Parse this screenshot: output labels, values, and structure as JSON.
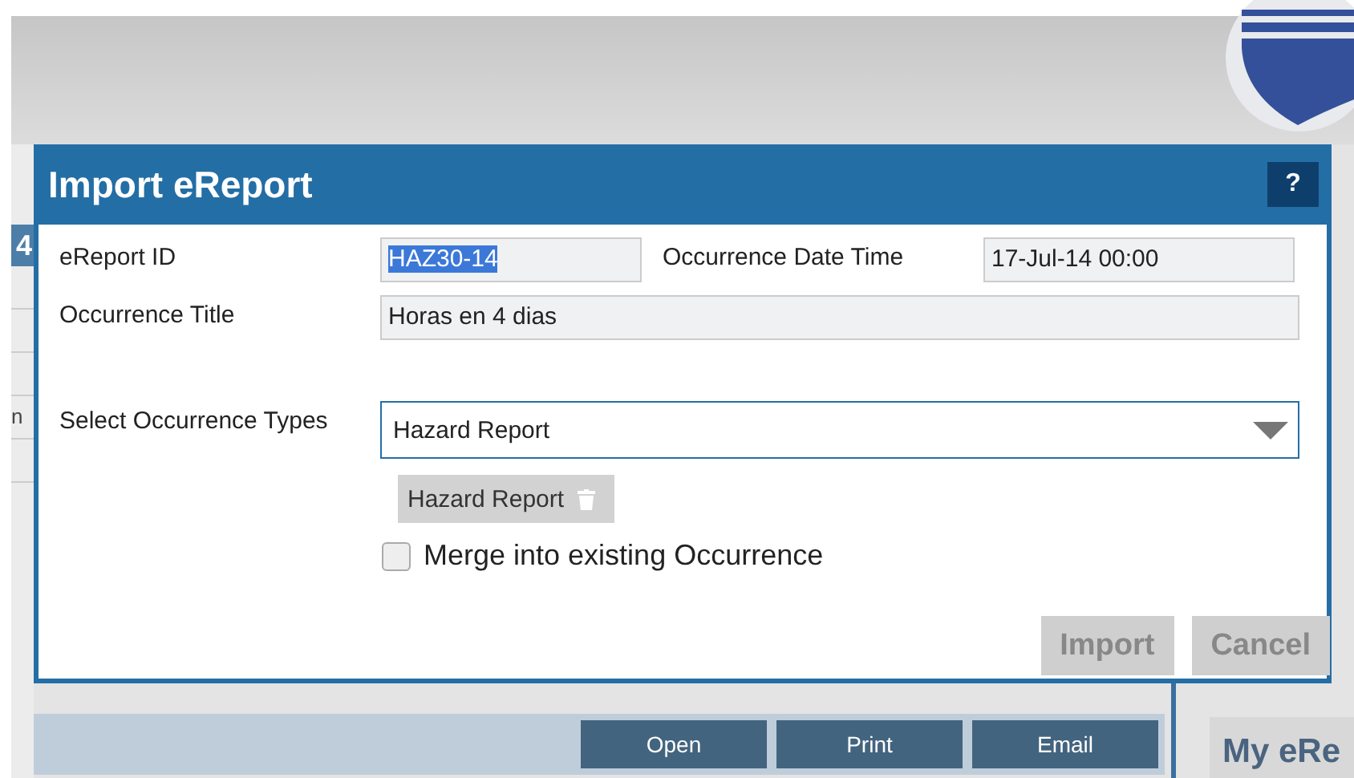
{
  "background": {
    "tab_fragment": "4",
    "row_fragment": "n",
    "toolbar_buttons": [
      "Open",
      "Print",
      "Email"
    ],
    "panel_title": "My eRe"
  },
  "dialog": {
    "title": "Import eReport",
    "help": "?",
    "report_id": {
      "label": "eReport ID",
      "value": "HAZ30-14"
    },
    "date_time": {
      "label": "Occurrence Date Time",
      "value": "17-Jul-14 00:00"
    },
    "occurrence_title": {
      "label": "Occurrence Title",
      "value": "Horas en 4 dias"
    },
    "types": {
      "label": "Select Occurrence Types",
      "value": "Hazard Report",
      "tags": [
        "Hazard Report"
      ]
    },
    "merge": {
      "label": "Merge into existing Occurrence",
      "checked": false
    },
    "buttons": [
      {
        "label": "Import",
        "disabled": true
      },
      {
        "label": "Cancel",
        "disabled": true
      }
    ]
  }
}
